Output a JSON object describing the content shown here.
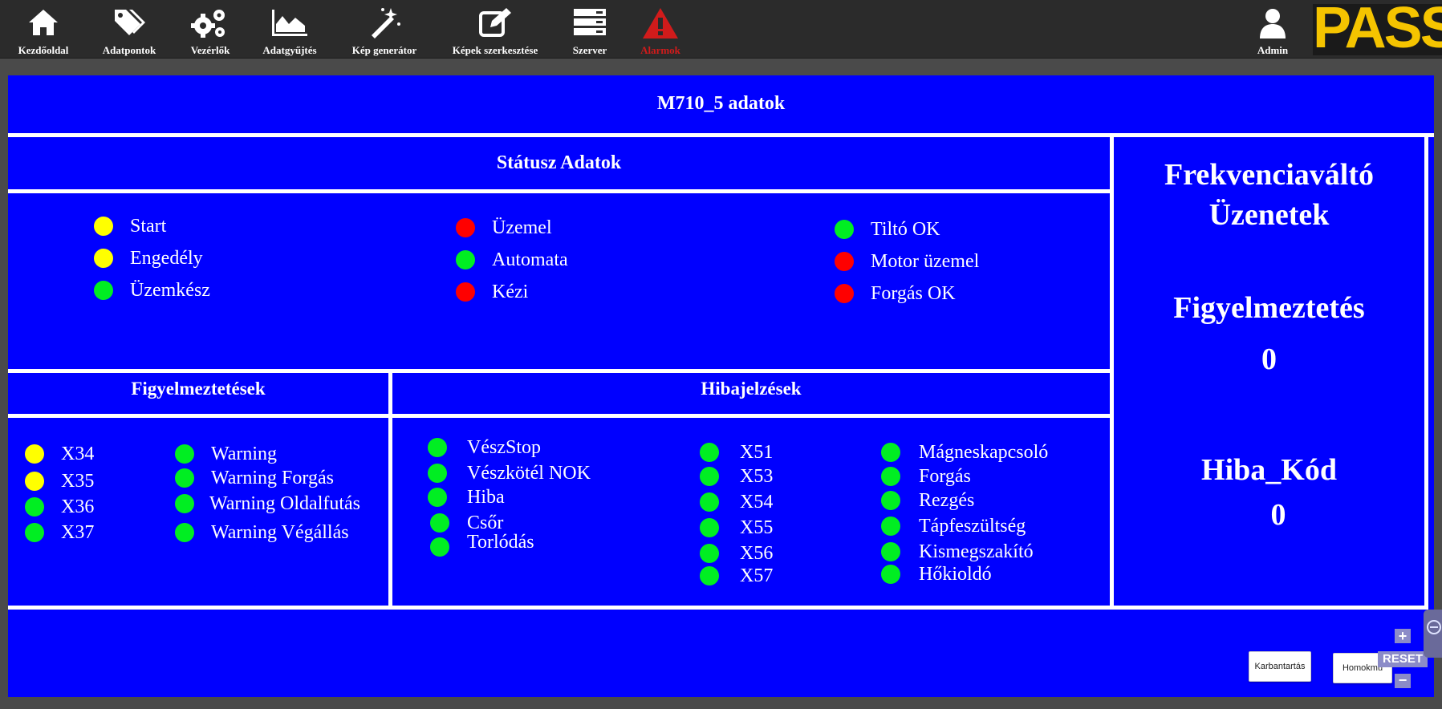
{
  "nav": {
    "items": [
      {
        "label": "Kezdőoldal",
        "icon": "home-icon"
      },
      {
        "label": "Adatpontok",
        "icon": "tags-icon"
      },
      {
        "label": "Vezérlők",
        "icon": "gears-icon"
      },
      {
        "label": "Adatgyűjtés",
        "icon": "area-chart-icon"
      },
      {
        "label": "Kép generátor",
        "icon": "magic-wand-icon"
      },
      {
        "label": "Képek szerkesztése",
        "icon": "edit-icon"
      },
      {
        "label": "Szerver",
        "icon": "server-icon"
      },
      {
        "label": "Alarmok",
        "icon": "warning-icon"
      }
    ],
    "user_label": "Admin",
    "logo_text": "PASS",
    "alarm_color": "#d11b1b",
    "logo_color": "#f5c400"
  },
  "page": {
    "title": "M710_5 adatok",
    "background_color": "#0000ff"
  },
  "status": {
    "title": "Státusz Adatok",
    "items": [
      {
        "label": "Start",
        "color": "yellow"
      },
      {
        "label": "Engedély",
        "color": "yellow"
      },
      {
        "label": "Üzemkész",
        "color": "green"
      },
      {
        "label": "Üzemel",
        "color": "red"
      },
      {
        "label": "Automata",
        "color": "green"
      },
      {
        "label": "Kézi",
        "color": "red"
      },
      {
        "label": "Tiltó OK",
        "color": "green"
      },
      {
        "label": "Motor üzemel",
        "color": "red"
      },
      {
        "label": "Forgás OK",
        "color": "red"
      }
    ]
  },
  "warnings": {
    "title": "Figyelmeztetések",
    "items": [
      {
        "label": "X34",
        "color": "yellow"
      },
      {
        "label": "X35",
        "color": "yellow"
      },
      {
        "label": "X36",
        "color": "green"
      },
      {
        "label": "X37",
        "color": "green"
      },
      {
        "label": "Warning",
        "color": "green"
      },
      {
        "label": "Warning Forgás",
        "color": "green"
      },
      {
        "label": "Warning Oldalfutás",
        "color": "green"
      },
      {
        "label": "Warning Végállás",
        "color": "green"
      }
    ]
  },
  "errors": {
    "title": "Hibajelzések",
    "items": [
      {
        "label": "VészStop",
        "color": "green"
      },
      {
        "label": "Vészkötél NOK",
        "color": "green"
      },
      {
        "label": "Hiba",
        "color": "green"
      },
      {
        "label": "Csőr",
        "color": "green"
      },
      {
        "label": "Torlódás",
        "color": "green"
      },
      {
        "label": "X51",
        "color": "green"
      },
      {
        "label": "X53",
        "color": "green"
      },
      {
        "label": "X54",
        "color": "green"
      },
      {
        "label": "X55",
        "color": "green"
      },
      {
        "label": "X56",
        "color": "green"
      },
      {
        "label": "X57",
        "color": "green"
      },
      {
        "label": "Mágneskapcsoló",
        "color": "green"
      },
      {
        "label": "Forgás",
        "color": "green"
      },
      {
        "label": "Rezgés",
        "color": "green"
      },
      {
        "label": "Tápfeszültség",
        "color": "green"
      },
      {
        "label": "Kismegszakító",
        "color": "green"
      },
      {
        "label": "Hőkioldó",
        "color": "green"
      }
    ]
  },
  "inverter": {
    "title_line1": "Frekvenciaváltó",
    "title_line2": "Üzenetek",
    "warning_label": "Figyelmeztetés",
    "warning_value": "0",
    "error_label": "Hiba_Kód",
    "error_value": "0"
  },
  "buttons": {
    "maintenance": "Karbantartás",
    "sandpump": "Homokmű"
  },
  "zoom": {
    "plus": "+",
    "reset": "RESET",
    "minus": "−"
  }
}
